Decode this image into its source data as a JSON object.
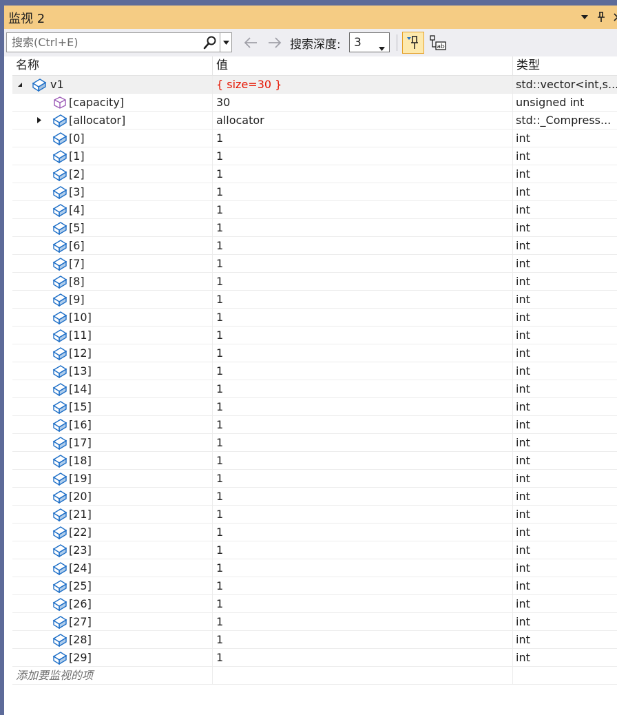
{
  "window": {
    "title": "监视 2",
    "dropdown_icon": "triangle-down-icon",
    "pin_icon": "pin-icon",
    "close_icon": "close-icon"
  },
  "toolbar": {
    "search_placeholder": "搜索(Ctrl+E)",
    "search_icon": "search-icon",
    "back_icon": "arrow-left-icon",
    "forward_icon": "arrow-right-icon",
    "depth_label": "搜索深度:",
    "depth_value": "3",
    "pin_toggle_icon": "pin-toolbar-icon",
    "format_icon": "hex-ab-icon",
    "accent_color": "#f5cc84"
  },
  "columns": {
    "name": "名称",
    "value": "值",
    "type": "类型"
  },
  "root": {
    "name": "v1",
    "value": "{ size=30 }",
    "type": "std::vector<int,s...",
    "value_color": "#e51400"
  },
  "children": [
    {
      "name": "[capacity]",
      "value": "30",
      "type": "unsigned int",
      "icon": "cube-purple-icon",
      "expandable": false
    },
    {
      "name": "[allocator]",
      "value": "allocator",
      "type": "std::_Compress...",
      "icon": "field-blue-icon",
      "expandable": true
    },
    {
      "name": "[0]",
      "value": "1",
      "type": "int"
    },
    {
      "name": "[1]",
      "value": "1",
      "type": "int"
    },
    {
      "name": "[2]",
      "value": "1",
      "type": "int"
    },
    {
      "name": "[3]",
      "value": "1",
      "type": "int"
    },
    {
      "name": "[4]",
      "value": "1",
      "type": "int"
    },
    {
      "name": "[5]",
      "value": "1",
      "type": "int"
    },
    {
      "name": "[6]",
      "value": "1",
      "type": "int"
    },
    {
      "name": "[7]",
      "value": "1",
      "type": "int"
    },
    {
      "name": "[8]",
      "value": "1",
      "type": "int"
    },
    {
      "name": "[9]",
      "value": "1",
      "type": "int"
    },
    {
      "name": "[10]",
      "value": "1",
      "type": "int"
    },
    {
      "name": "[11]",
      "value": "1",
      "type": "int"
    },
    {
      "name": "[12]",
      "value": "1",
      "type": "int"
    },
    {
      "name": "[13]",
      "value": "1",
      "type": "int"
    },
    {
      "name": "[14]",
      "value": "1",
      "type": "int"
    },
    {
      "name": "[15]",
      "value": "1",
      "type": "int"
    },
    {
      "name": "[16]",
      "value": "1",
      "type": "int"
    },
    {
      "name": "[17]",
      "value": "1",
      "type": "int"
    },
    {
      "name": "[18]",
      "value": "1",
      "type": "int"
    },
    {
      "name": "[19]",
      "value": "1",
      "type": "int"
    },
    {
      "name": "[20]",
      "value": "1",
      "type": "int"
    },
    {
      "name": "[21]",
      "value": "1",
      "type": "int"
    },
    {
      "name": "[22]",
      "value": "1",
      "type": "int"
    },
    {
      "name": "[23]",
      "value": "1",
      "type": "int"
    },
    {
      "name": "[24]",
      "value": "1",
      "type": "int"
    },
    {
      "name": "[25]",
      "value": "1",
      "type": "int"
    },
    {
      "name": "[26]",
      "value": "1",
      "type": "int"
    },
    {
      "name": "[27]",
      "value": "1",
      "type": "int"
    },
    {
      "name": "[28]",
      "value": "1",
      "type": "int"
    },
    {
      "name": "[29]",
      "value": "1",
      "type": "int"
    }
  ],
  "add_item": "添加要监视的项"
}
